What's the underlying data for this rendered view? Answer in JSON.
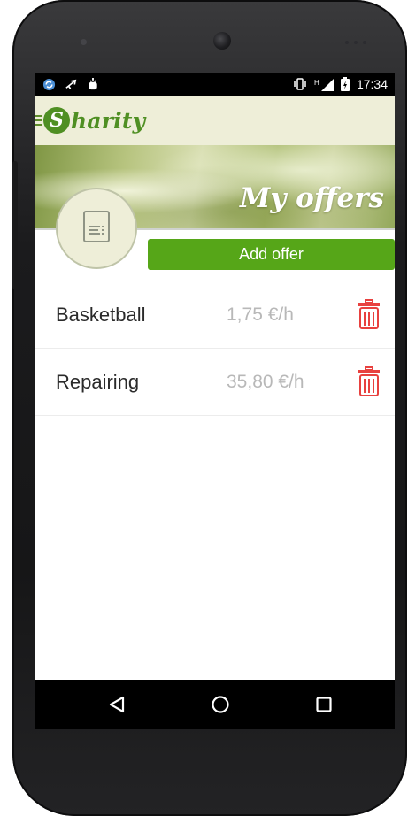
{
  "status_bar": {
    "time": "17:34",
    "left_icons": [
      "sync-icon",
      "usb-icon",
      "android-debug-icon"
    ],
    "right_icons": [
      "vibrate-icon",
      "signal-h-icon",
      "battery-charging-icon"
    ],
    "network_label": "H"
  },
  "app_bar": {
    "logo_initial": "S",
    "logo_text": "harity",
    "menu_icon": "hamburger-icon"
  },
  "header": {
    "title": "My offers",
    "avatar_icon": "document-list-icon"
  },
  "actions": {
    "add_offer_label": "Add offer"
  },
  "offers": [
    {
      "name": "Basketball",
      "price": "1,75 €/h",
      "delete_icon": "trash-icon"
    },
    {
      "name": "Repairing",
      "price": "35,80 €/h",
      "delete_icon": "trash-icon"
    }
  ],
  "nav_bar": {
    "back_icon": "back-triangle-icon",
    "home_icon": "home-circle-icon",
    "recents_icon": "recents-square-icon"
  },
  "colors": {
    "accent_green": "#56a618",
    "logo_green": "#4f8f23",
    "app_bar_bg": "#eeeed8",
    "trash_red": "#e8413f",
    "price_gray": "#b8b8b8"
  }
}
